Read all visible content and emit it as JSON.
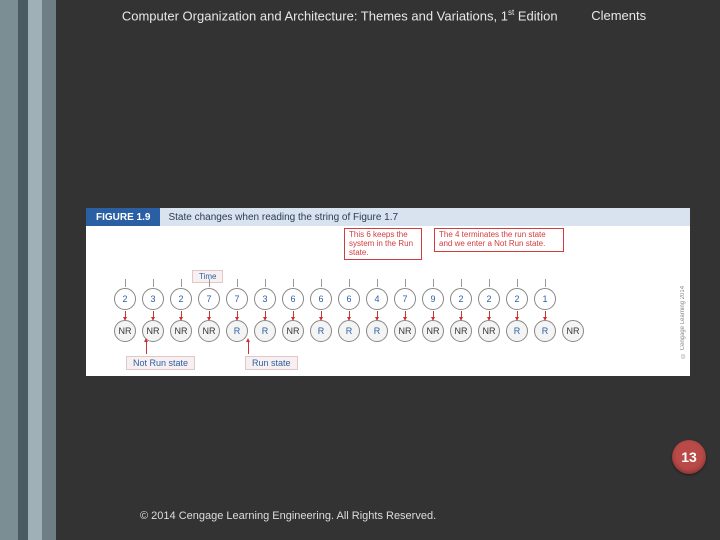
{
  "header": {
    "title_prefix": "Computer Organization and Architecture: Themes and Variations, 1",
    "title_sup": "st",
    "title_suffix": " Edition",
    "author": "Clements"
  },
  "figure": {
    "label": "FIGURE 1.9",
    "caption": "State changes when reading the string of Figure 1.7",
    "callout1": "This 6 keeps the system in the Run state.",
    "callout2": "The 4 terminates the run state and we enter a Not Run state.",
    "time_label": "Time",
    "values": [
      "2",
      "3",
      "2",
      "7",
      "7",
      "3",
      "6",
      "6",
      "6",
      "4",
      "7",
      "9",
      "2",
      "2",
      "2",
      "1"
    ],
    "states": [
      "NR",
      "NR",
      "NR",
      "NR",
      "R",
      "R",
      "NR",
      "R",
      "R",
      "R",
      "NR",
      "NR",
      "NR",
      "NR",
      "R",
      "R",
      "NR"
    ],
    "legend1": "Not Run state",
    "legend2": "Run state",
    "credit": "© Cengage Learning 2014"
  },
  "page_number": "13",
  "copyright": "© 2014 Cengage Learning Engineering. All Rights Reserved."
}
